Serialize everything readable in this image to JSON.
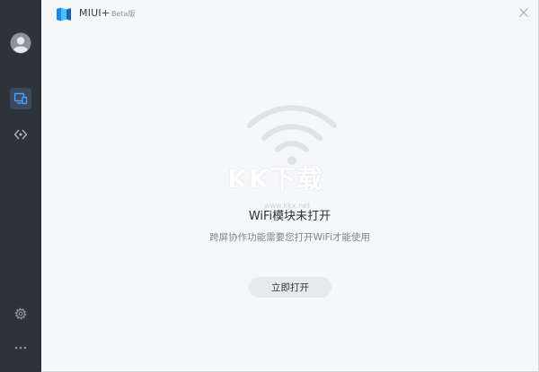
{
  "titlebar": {
    "app_name": "MIUI+",
    "badge": "Beta版"
  },
  "sidebar": {
    "items": [
      {
        "name": "avatar",
        "icon": "user-avatar-icon"
      },
      {
        "name": "devices",
        "icon": "devices-icon",
        "active": true
      },
      {
        "name": "connect",
        "icon": "cross-device-icon"
      },
      {
        "name": "settings",
        "icon": "gear-icon"
      },
      {
        "name": "more",
        "icon": "more-dots-icon"
      }
    ]
  },
  "main": {
    "status_title": "WiFi模块未打开",
    "status_desc": "跨屏协作功能需要您打开WiFi才能使用",
    "open_button_label": "立即打开"
  },
  "watermark": {
    "text": "KK下载",
    "sub": "www.kkx.net"
  },
  "colors": {
    "sidebar_bg": "#2d323b",
    "main_bg": "#f6f7f9",
    "active_item_bg": "#3b4a5e",
    "accent_blue": "#4aa3ff",
    "button_bg": "#e6eaee"
  }
}
